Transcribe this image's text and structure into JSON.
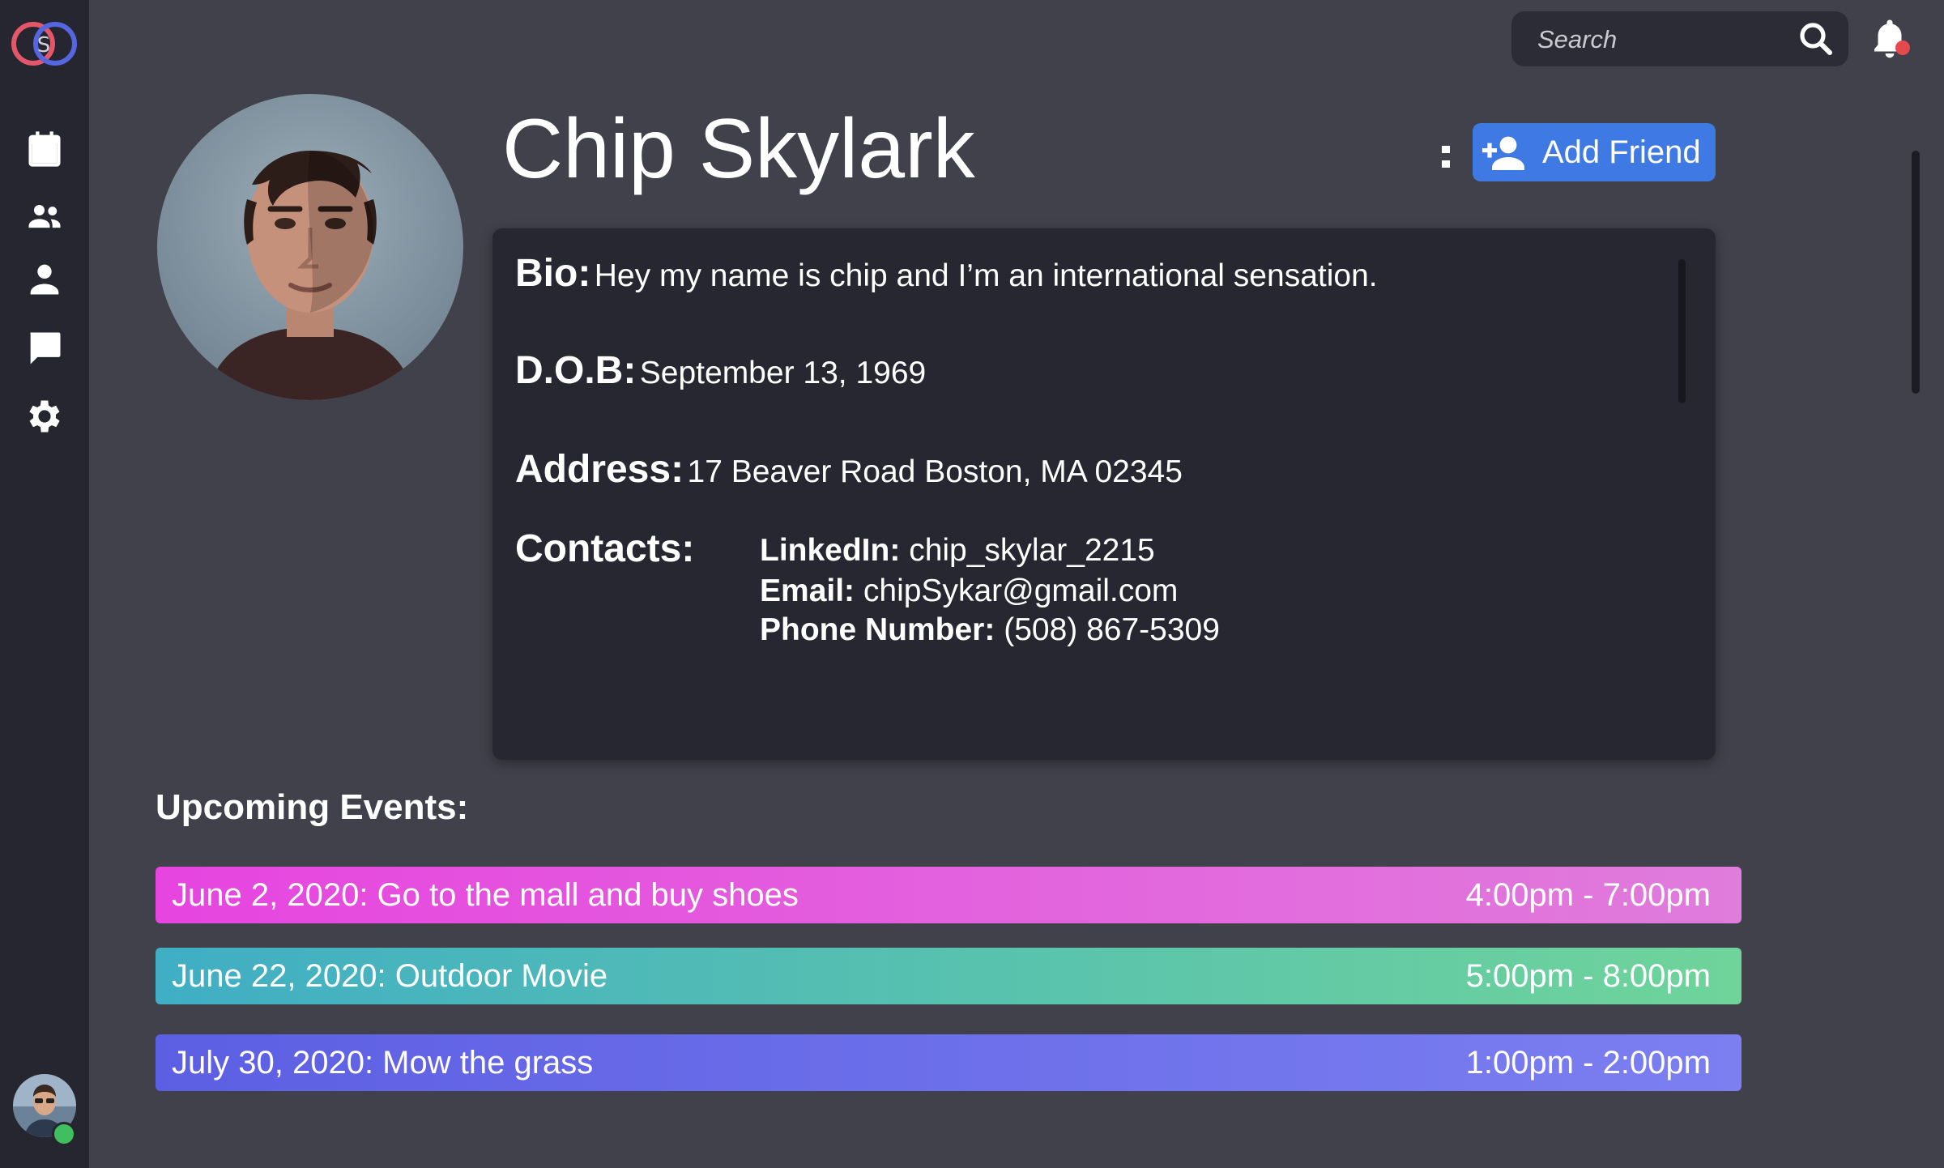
{
  "colors": {
    "background": "#40414b",
    "sidebar": "#25262f",
    "card": "#262730",
    "accent_button": "#3f7ae4",
    "online": "#3fbf5f",
    "notification": "#e5484d"
  },
  "sidebar": {
    "logo_icon": "interlocking-rings-logo",
    "items": [
      {
        "icon": "calendar-icon"
      },
      {
        "icon": "people-icon"
      },
      {
        "icon": "person-icon"
      },
      {
        "icon": "chat-icon"
      },
      {
        "icon": "gear-icon"
      }
    ]
  },
  "header": {
    "search_placeholder": "Search"
  },
  "profile": {
    "name": "Chip Skylark",
    "more_symbol": ":",
    "add_friend_label": "Add Friend",
    "bio_label": "Bio:",
    "bio": "Hey my name is chip and I’m an international sensation.",
    "dob_label": "D.O.B:",
    "dob": "September 13, 1969",
    "address_label": "Address:",
    "address": "17 Beaver Road Boston, MA 02345",
    "contacts_label": "Contacts:",
    "contacts": {
      "linkedin_label": "LinkedIn:",
      "linkedin": "chip_skylar_2215",
      "email_label": "Email:",
      "email": "chipSykar@gmail.com",
      "phone_label": "Phone Number:",
      "phone": "(508) 867-5309"
    }
  },
  "events": {
    "heading": "Upcoming Events:",
    "items": [
      {
        "title": "June 2, 2020: Go to the mall and buy shoes",
        "time": "4:00pm - 7:00pm",
        "color_start": "#e645df",
        "color_end": "#e07cdc"
      },
      {
        "title": "June 22, 2020: Outdoor Movie",
        "time": "5:00pm - 8:00pm",
        "color_start": "#40aec4",
        "color_end": "#6fd49a"
      },
      {
        "title": "July 30, 2020: Mow the grass",
        "time": "1:00pm - 2:00pm",
        "color_start": "#5d5fe3",
        "color_end": "#7b7ff0"
      }
    ]
  }
}
